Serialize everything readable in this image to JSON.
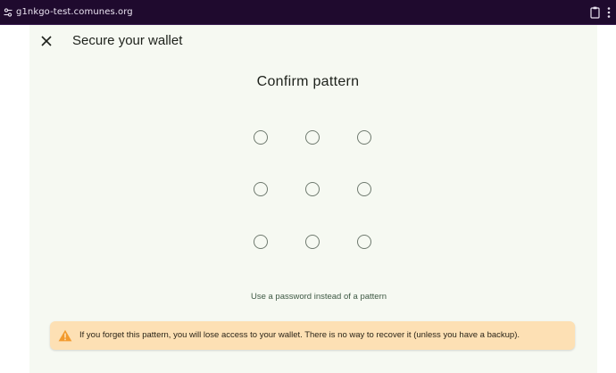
{
  "browser": {
    "url": "g1nkgo-test.comunes.org",
    "icons": [
      "site-settings-icon",
      "clipboard-icon",
      "menu-icon"
    ]
  },
  "header": {
    "title": "Secure your wallet",
    "close_icon": "close-icon"
  },
  "pattern": {
    "title": "Confirm pattern",
    "dots": 9,
    "alt_link": "Use a password instead of a pattern"
  },
  "warning": {
    "icon": "warning-icon",
    "text": "If you forget this pattern, you will lose access to your wallet. There is no way to recover it (unless you have a backup)."
  },
  "colors": {
    "browser_bar": "#1f0a2e",
    "panel_background": "#f6f9f2",
    "warning_background": "#fde0b4",
    "warning_icon": "#f29a2e",
    "dot_border": "#6f7a6f"
  }
}
